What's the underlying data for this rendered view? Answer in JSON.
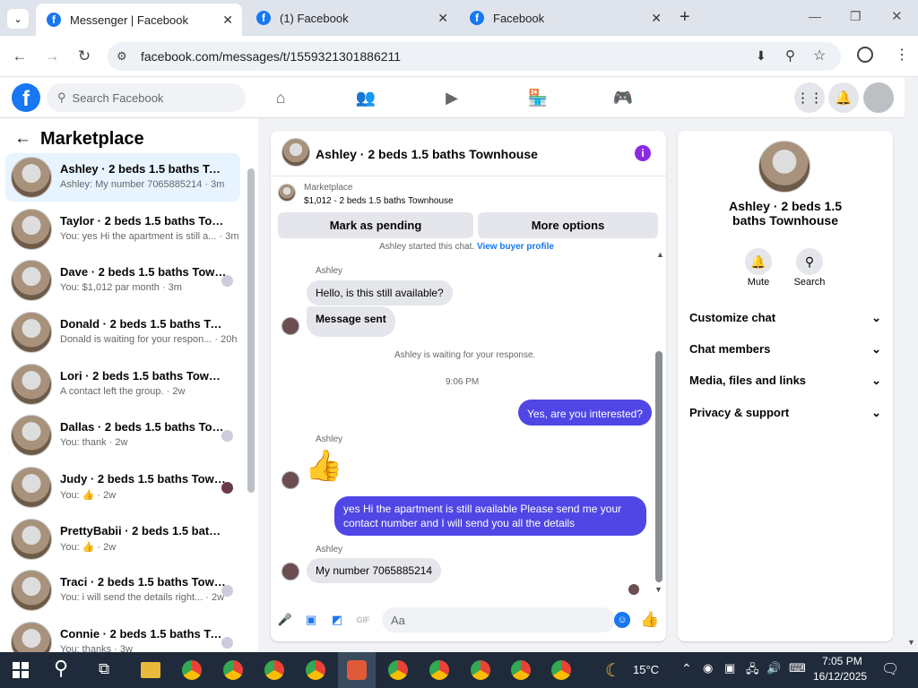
{
  "browser": {
    "tabs": [
      {
        "title": "Messenger | Facebook"
      },
      {
        "title": "(1) Facebook"
      },
      {
        "title": "Facebook"
      }
    ],
    "url": "facebook.com/messages/t/1559321301886211"
  },
  "header": {
    "search_placeholder": "Search Facebook",
    "logo_letter": "f"
  },
  "left": {
    "title": "Marketplace",
    "conversations": [
      {
        "name": "Ashley · 2 beds 1.5 baths Townh...",
        "snippet": "Ashley: My number 7065885214 · 3m"
      },
      {
        "name": "Taylor · 2 beds 1.5 baths Townh...",
        "snippet": "You: yes Hi the apartment is still a... · 3m"
      },
      {
        "name": "Dave · 2 beds 1.5 baths Town...",
        "snippet": "You: $1,012 par month · 3m"
      },
      {
        "name": "Donald · 2 beds 1.5 baths Town...",
        "snippet": "Donald is waiting for your respon... · 20h"
      },
      {
        "name": "Lori · 2 beds 1.5 baths Townhouse",
        "snippet": "A contact left the group. · 2w"
      },
      {
        "name": "Dallas · 2 beds 1.5 baths Town...",
        "snippet": "You: thank · 2w"
      },
      {
        "name": "Judy · 2 beds 1.5 baths Townh...",
        "snippet": "You: 👍 · 2w"
      },
      {
        "name": "PrettyBabii · 2 beds 1.5 baths To...",
        "snippet": "You: 👍 · 2w"
      },
      {
        "name": "Traci · 2 beds 1.5 baths Townh...",
        "snippet": "You: i will send the details right... · 2w"
      },
      {
        "name": "Connie · 2 beds 1.5 baths Tow...",
        "snippet": "You: thanks · 3w"
      }
    ]
  },
  "chat": {
    "title": "Ashley · 2 beds 1.5 baths Townhouse",
    "marketplace_label": "Marketplace",
    "listing": "$1,012 - 2 beds 1.5 baths Townhouse",
    "mark_pending": "Mark as pending",
    "more_options": "More options",
    "started_text": "Ashley started this chat.",
    "view_buyer": "View buyer profile",
    "sender_name": "Ashley",
    "msg1": "Hello, is this still available?",
    "msg2": "Message sent",
    "waiting": "Ashley is waiting for your response.",
    "time": "9:06 PM",
    "out1": "Yes, are you interested?",
    "out2": "yes Hi the apartment is still available Please send me your contact number and I will send you all the details",
    "msg3": "My number 7065885214",
    "input_placeholder": "Aa"
  },
  "right": {
    "name": "Ashley · 2 beds 1.5 baths Townhouse",
    "mute": "Mute",
    "search": "Search",
    "sections": [
      "Customize chat",
      "Chat members",
      "Media, files and links",
      "Privacy & support"
    ]
  },
  "taskbar": {
    "temp": "15°C",
    "time": "7:05 PM",
    "date": "16/12/2025"
  },
  "colors": {
    "fb_blue": "#1877f2",
    "outgoing_bubble": "#4f46e5",
    "selected_conv": "#e7f3ff"
  }
}
